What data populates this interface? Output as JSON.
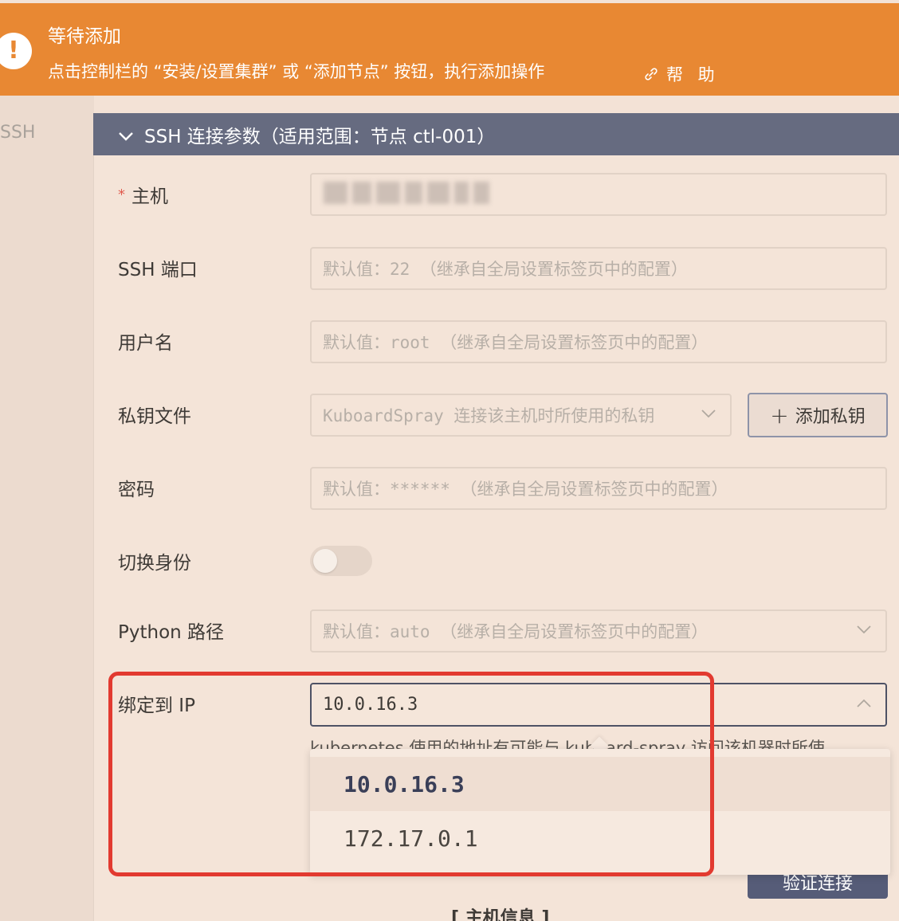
{
  "alert": {
    "icon": "exclamation-icon",
    "title": "等待添加",
    "description": "点击控制栏的 “安装/设置集群” 或 “添加节点” 按钮，执行添加操作",
    "help": "帮 助",
    "color": "#e88833"
  },
  "left_tab": {
    "label": "SSH"
  },
  "panel": {
    "title": "SSH 连接参数（适用范围：节点 ctl-001）"
  },
  "form": {
    "host": {
      "required_mark": "*",
      "label": "主机"
    },
    "ssh_port": {
      "label": "SSH 端口",
      "placeholder": "默认值：22 （继承自全局设置标签页中的配置）"
    },
    "username": {
      "label": "用户名",
      "placeholder": "默认值：root （继承自全局设置标签页中的配置）"
    },
    "private_key": {
      "label": "私钥文件",
      "placeholder": "KuboardSpray 连接该主机时所使用的私钥",
      "add_button": "添加私钥"
    },
    "password": {
      "label": "密码",
      "placeholder": "默认值：****** （继承自全局设置标签页中的配置）"
    },
    "become": {
      "label": "切换身份",
      "enabled": false
    },
    "python_path": {
      "label": "Python 路径",
      "placeholder": "默认值：auto （继承自全局设置标签页中的配置）"
    },
    "bind_ip": {
      "label": "绑定到 IP",
      "value": "10.0.16.3",
      "hint": "kubernetes 使用的地址有可能与 kuboard-spray 访问该机器时所使",
      "options": [
        "10.0.16.3",
        "172.17.0.1"
      ],
      "selected": "10.0.16.3"
    }
  },
  "verify_button": "验证连接",
  "host_info": "[ 主机信息 ]",
  "colors": {
    "header": "#666b80",
    "highlight": "#e23a30",
    "button": "#565c78"
  }
}
